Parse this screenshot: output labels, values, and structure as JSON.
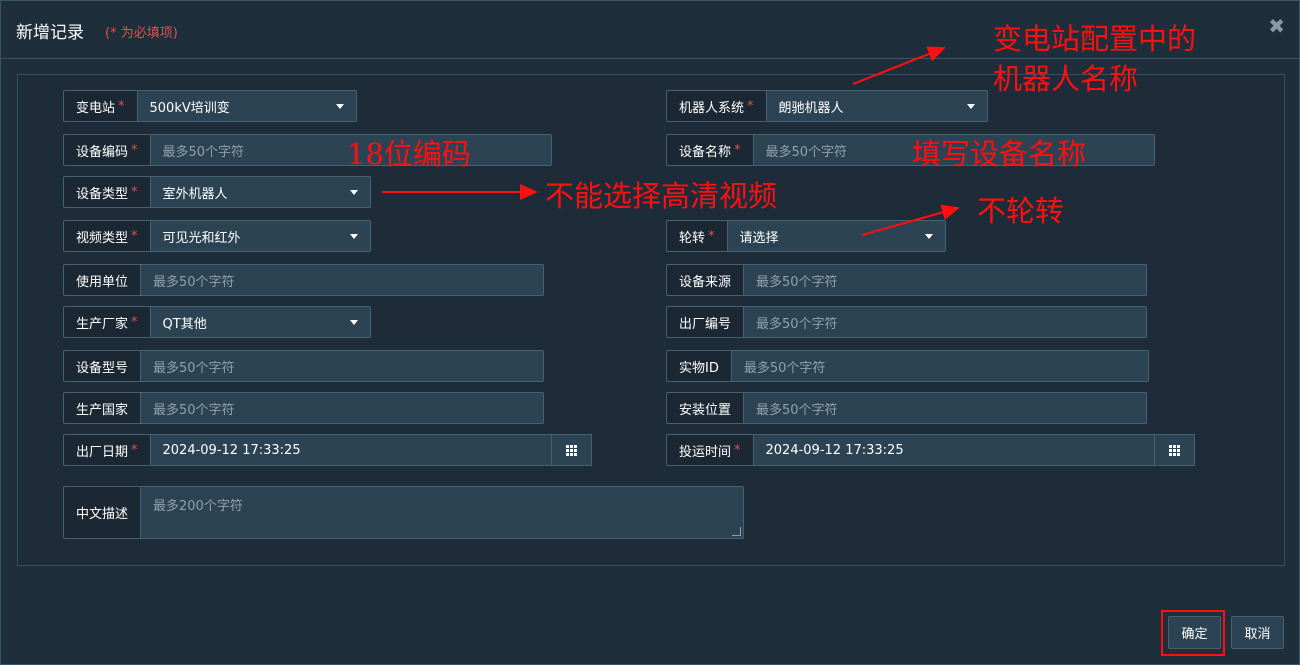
{
  "dialog": {
    "title": "新增记录",
    "required_hint": "(* 为必填项)",
    "close_glyph": "✖"
  },
  "fields": {
    "substation": {
      "label": "变电站",
      "value": "500kV培训变"
    },
    "robot_system": {
      "label": "机器人系统",
      "value": "朗驰机器人"
    },
    "device_code": {
      "label": "设备编码",
      "placeholder": "最多50个字符"
    },
    "device_name": {
      "label": "设备名称",
      "placeholder": "最多50个字符"
    },
    "device_type": {
      "label": "设备类型",
      "value": "室外机器人"
    },
    "video_type": {
      "label": "视频类型",
      "value": "可见光和红外"
    },
    "rotation": {
      "label": "轮转",
      "value": "请选择"
    },
    "user_unit": {
      "label": "使用单位",
      "placeholder": "最多50个字符"
    },
    "device_source": {
      "label": "设备来源",
      "placeholder": "最多50个字符"
    },
    "manufacturer": {
      "label": "生产厂家",
      "value": "QT其他"
    },
    "factory_number": {
      "label": "出厂编号",
      "placeholder": "最多50个字符"
    },
    "device_model": {
      "label": "设备型号",
      "placeholder": "最多50个字符"
    },
    "physical_id": {
      "label": "实物ID",
      "placeholder": "最多50个字符"
    },
    "production_country": {
      "label": "生产国家",
      "placeholder": "最多50个字符"
    },
    "install_location": {
      "label": "安装位置",
      "placeholder": "最多50个字符"
    },
    "factory_date": {
      "label": "出厂日期",
      "value": "2024-09-12 17:33:25"
    },
    "commission_time": {
      "label": "投运时间",
      "value": "2024-09-12 17:33:25"
    },
    "description": {
      "label": "中文描述",
      "placeholder": "最多200个字符"
    }
  },
  "annotations": {
    "robot_name": "变电站配置中的",
    "robot_name_line2": "机器人名称",
    "code_18": "18位编码",
    "fill_name": "填写设备名称",
    "no_hd": "不能选择高清视频",
    "no_rotate": "不轮转"
  },
  "footer": {
    "confirm_label": "确定",
    "cancel_label": "取消"
  },
  "colors": {
    "background": "#1f2e3b",
    "input": "#2b4353",
    "required": "#e05050",
    "annotation": "#ff1010"
  },
  "icons": {
    "calendar": "calendar-grid-icon",
    "dropdown": "caret-down-icon",
    "close": "close-icon"
  }
}
